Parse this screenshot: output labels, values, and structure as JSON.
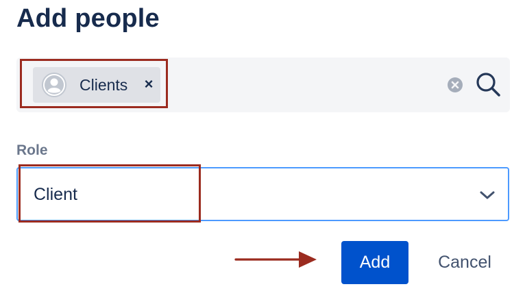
{
  "dialog": {
    "title": "Add people"
  },
  "people_picker": {
    "chips": [
      {
        "label": "Clients",
        "icon": "user-avatar-icon",
        "remove_symbol": "×"
      }
    ],
    "icons": [
      "clear-icon",
      "search-icon"
    ]
  },
  "role": {
    "label": "Role",
    "selected": "Client",
    "icon": "chevron-down-icon"
  },
  "actions": {
    "add_label": "Add",
    "cancel_label": "Cancel"
  },
  "colors": {
    "primary": "#0052cc",
    "focus_border": "#4c9aff",
    "annotation": "#9b2b1f",
    "title": "#172b4d"
  }
}
